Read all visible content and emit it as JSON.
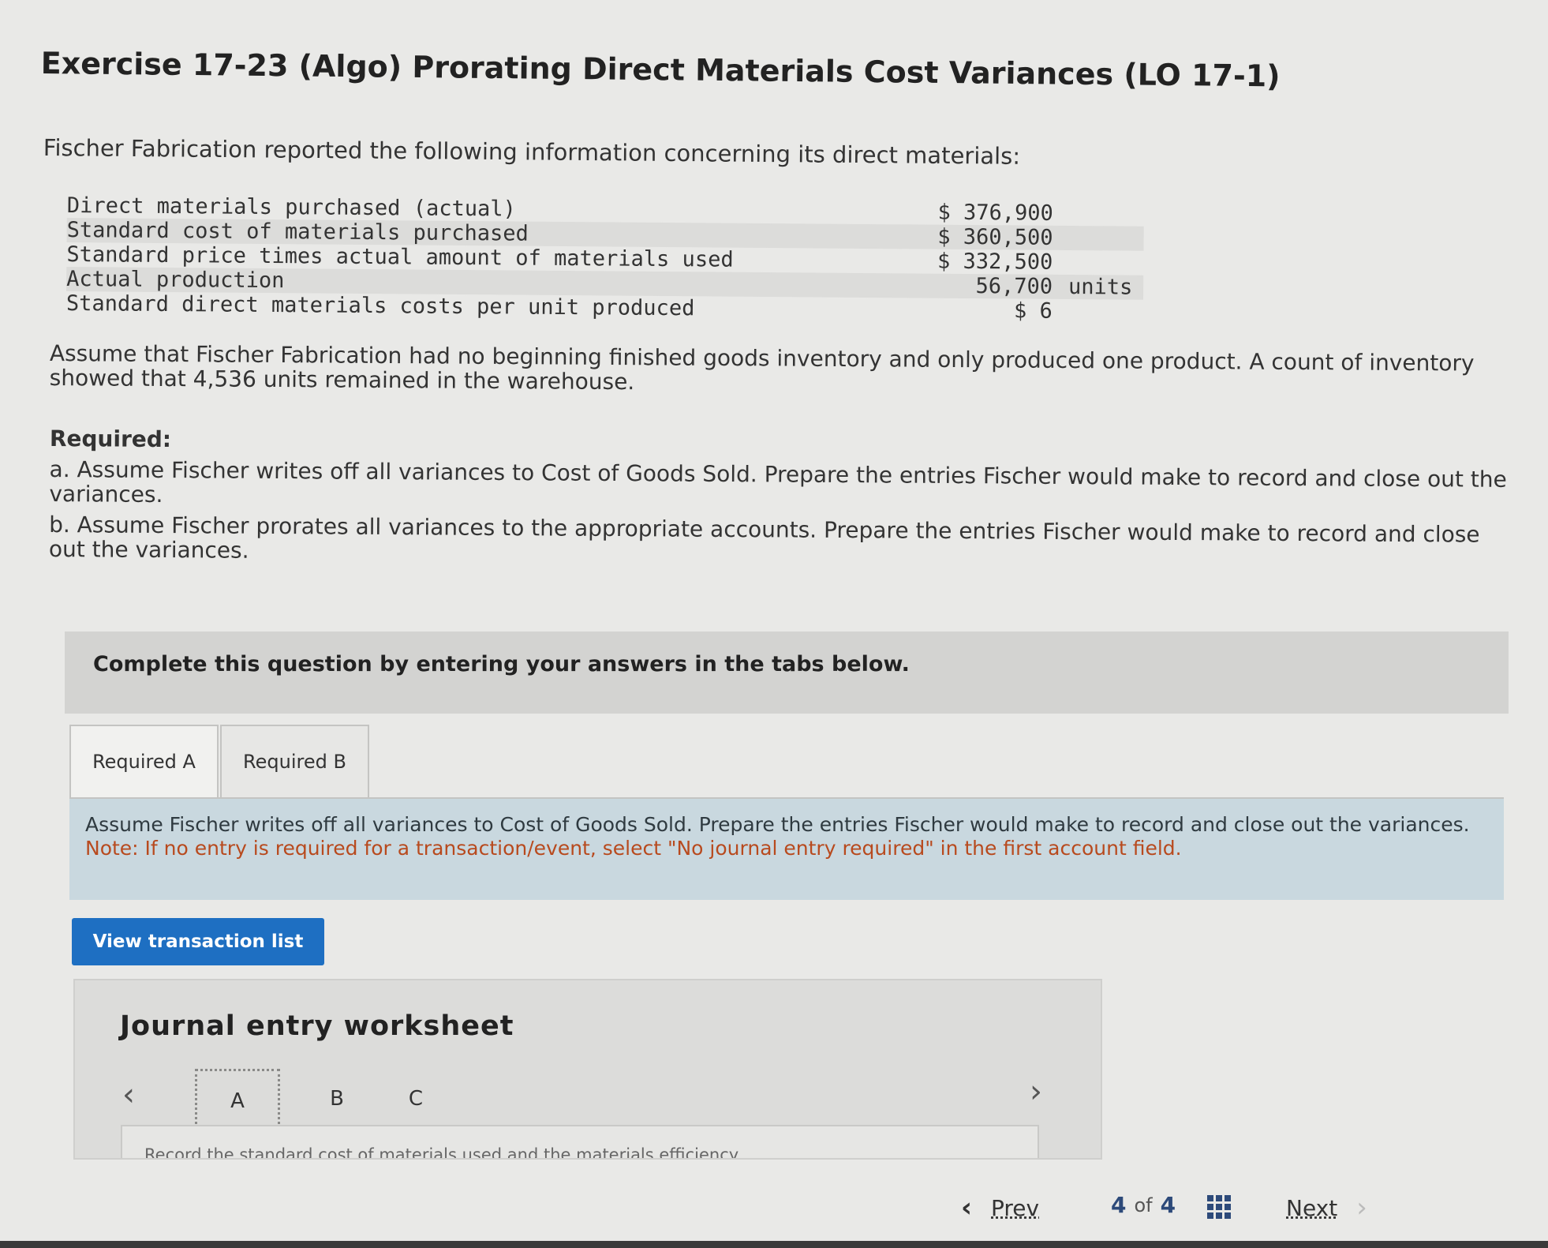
{
  "title": "Exercise 17-23 (Algo) Prorating Direct Materials Cost Variances (LO 17-1)",
  "intro": "Fischer Fabrication reported the following information concerning its direct materials:",
  "data_rows": [
    {
      "label": "Direct materials purchased (actual)",
      "value": "$ 376,900",
      "unit": ""
    },
    {
      "label": "Standard cost of materials purchased",
      "value": "$ 360,500",
      "unit": ""
    },
    {
      "label": "Standard price times actual amount of materials used",
      "value": "$ 332,500",
      "unit": ""
    },
    {
      "label": "Actual production",
      "value": "56,700",
      "unit": "units"
    },
    {
      "label": "Standard direct materials costs per unit produced",
      "value": "$ 6",
      "unit": ""
    }
  ],
  "assumption": "Assume that Fischer Fabrication had no beginning finished goods inventory and only produced one product. A count of inventory showed that 4,536 units remained in the warehouse.",
  "required": {
    "heading": "Required:",
    "a": "a. Assume Fischer writes off all variances to Cost of Goods Sold. Prepare the entries Fischer would make to record and close out the variances.",
    "b": "b. Assume Fischer prorates all variances to the appropriate accounts. Prepare the entries Fischer would make to record and close out the variances."
  },
  "banner": "Complete this question by entering your answers in the tabs below.",
  "tabs": [
    {
      "label": "Required A",
      "active": true
    },
    {
      "label": "Required B",
      "active": false
    }
  ],
  "instructions": {
    "text": "Assume Fischer writes off all variances to Cost of Goods Sold. Prepare the entries Fischer would make to record and close out the variances.",
    "note": "Note: If no entry is required for a transaction/event, select \"No journal entry required\" in the first account field."
  },
  "view_button": "View transaction list",
  "worksheet": {
    "title": "Journal entry worksheet",
    "tabs": [
      "A",
      "B",
      "C"
    ],
    "active_tab": "A",
    "prev_icon": "chevron-left-icon",
    "next_icon": "chevron-right-icon",
    "panel_text": "Record the standard cost of materials used and the materials efficiency"
  },
  "pager": {
    "prev": "Prev",
    "page_current": "4",
    "page_of": "of",
    "page_total": "4",
    "next": "Next"
  },
  "colors": {
    "accent": "#1e6fc2",
    "note": "#b84a1e",
    "instructions_bg": "#c9d8df"
  }
}
